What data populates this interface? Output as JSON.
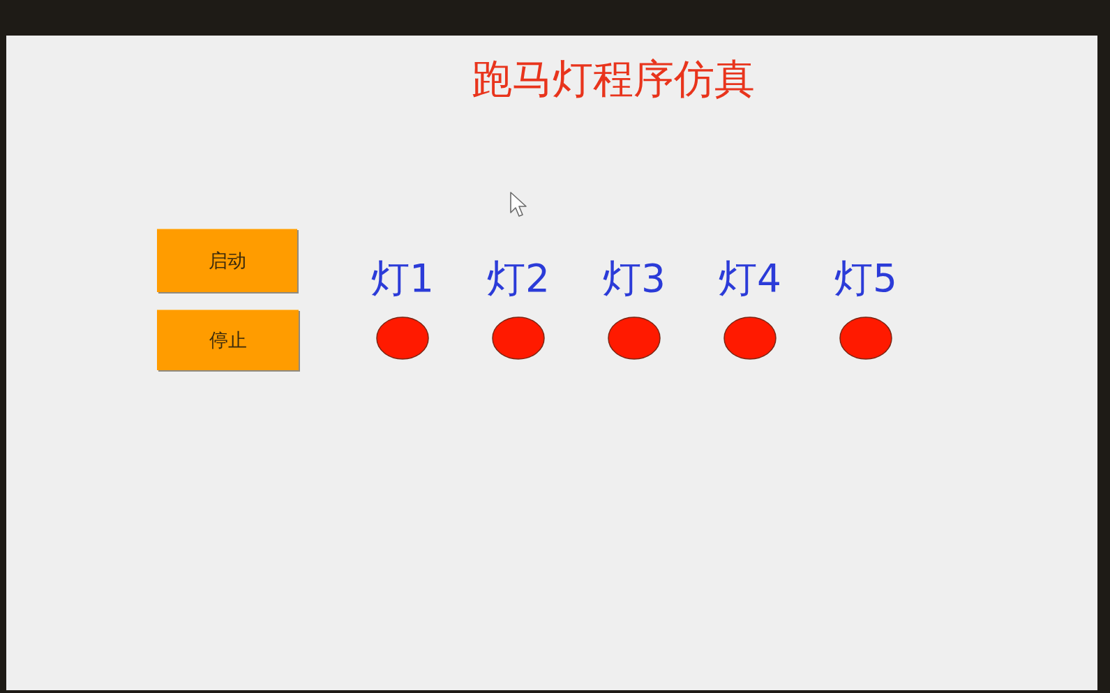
{
  "title": "跑马灯程序仿真",
  "buttons": [
    "启动",
    "停止"
  ],
  "lamps": [
    {
      "label": "灯1"
    },
    {
      "label": "灯2"
    },
    {
      "label": "灯3"
    },
    {
      "label": "灯4"
    },
    {
      "label": "灯5"
    }
  ]
}
